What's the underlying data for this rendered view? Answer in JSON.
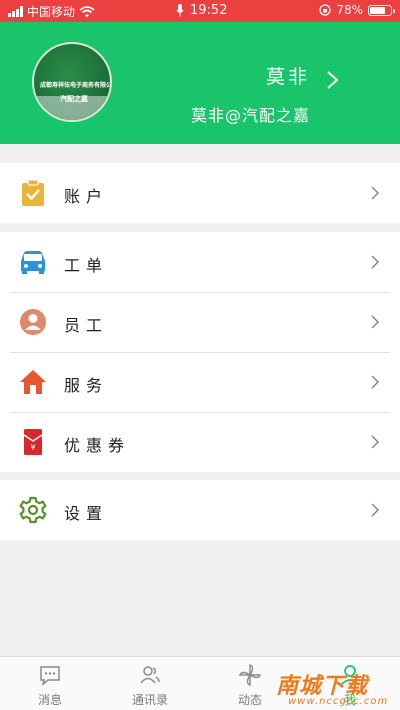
{
  "status_bar": {
    "carrier": "中国移动",
    "time": "19:52",
    "battery": "78%",
    "battery_level": 0.78,
    "color": "#ec3f3f"
  },
  "profile": {
    "name": "莫非",
    "subtitle": "莫非@汽配之嘉",
    "avatar_ring_text": "成都寿祥伍电子商务有限公司",
    "avatar_center_text": "汽配之嘉",
    "header_color": "#19c46a"
  },
  "menu": {
    "account": {
      "label": "账户",
      "icon": "account-check-icon",
      "icon_color": "#e8b53b"
    },
    "orders": {
      "label": "工单",
      "icon": "car-icon",
      "icon_color": "#2d92d6"
    },
    "staff": {
      "label": "员工",
      "icon": "person-icon",
      "icon_color": "#e0896a"
    },
    "service": {
      "label": "服务",
      "icon": "home-icon",
      "icon_color": "#e9572e"
    },
    "coupons": {
      "label": "优惠券",
      "icon": "coupon-icon",
      "icon_color": "#d9272e"
    },
    "settings": {
      "label": "设置",
      "icon": "gear-icon",
      "icon_color": "#5a8f2e"
    }
  },
  "tabbar": {
    "tabs": [
      {
        "label": "消息",
        "icon": "message-icon"
      },
      {
        "label": "通讯录",
        "icon": "contacts-icon"
      },
      {
        "label": "动态",
        "icon": "pinwheel-icon"
      },
      {
        "label": "我",
        "icon": "me-icon"
      }
    ],
    "active_index": 3,
    "active_color": "#19c46a"
  },
  "watermark": {
    "title": "南城下载",
    "url": "www.nccgcc.com"
  }
}
